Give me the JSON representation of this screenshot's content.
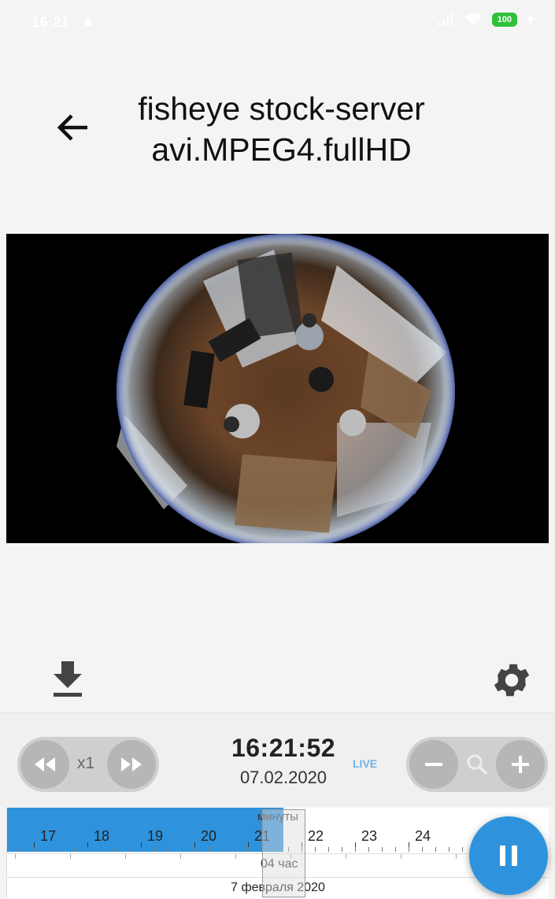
{
  "status_bar": {
    "time": "16:21",
    "battery": "100",
    "icons": [
      "bug-icon",
      "signal-icon",
      "wifi-icon",
      "battery-icon",
      "charging-icon"
    ]
  },
  "header": {
    "back_icon": "arrow-left-icon",
    "title_line1": "fisheye stock-server",
    "title_line2": "avi.MPEG4.fullHD"
  },
  "video": {
    "content": "fisheye-camera-view"
  },
  "actions": {
    "download_icon": "download-icon",
    "settings_icon": "gear-icon"
  },
  "playback": {
    "rewind_icon": "rewind-icon",
    "speed": "x1",
    "forward_icon": "fast-forward-icon",
    "time": "16:21:52",
    "date": "07.02.2020",
    "live_label": "LIVE",
    "zoom_out_icon": "minus-icon",
    "zoom_icon": "magnifier-icon",
    "zoom_in_icon": "plus-icon"
  },
  "timeline": {
    "unit_label": "минуты",
    "minute_ticks": [
      "17",
      "18",
      "19",
      "20",
      "21",
      "22",
      "23",
      "24"
    ],
    "hour_label": "04 час",
    "date_label": "7 февраля 2020"
  },
  "fab": {
    "icon": "pause-icon"
  },
  "colors": {
    "accent": "#2e93dc",
    "live": "#6fb2e6",
    "battery": "#2fc13a"
  }
}
